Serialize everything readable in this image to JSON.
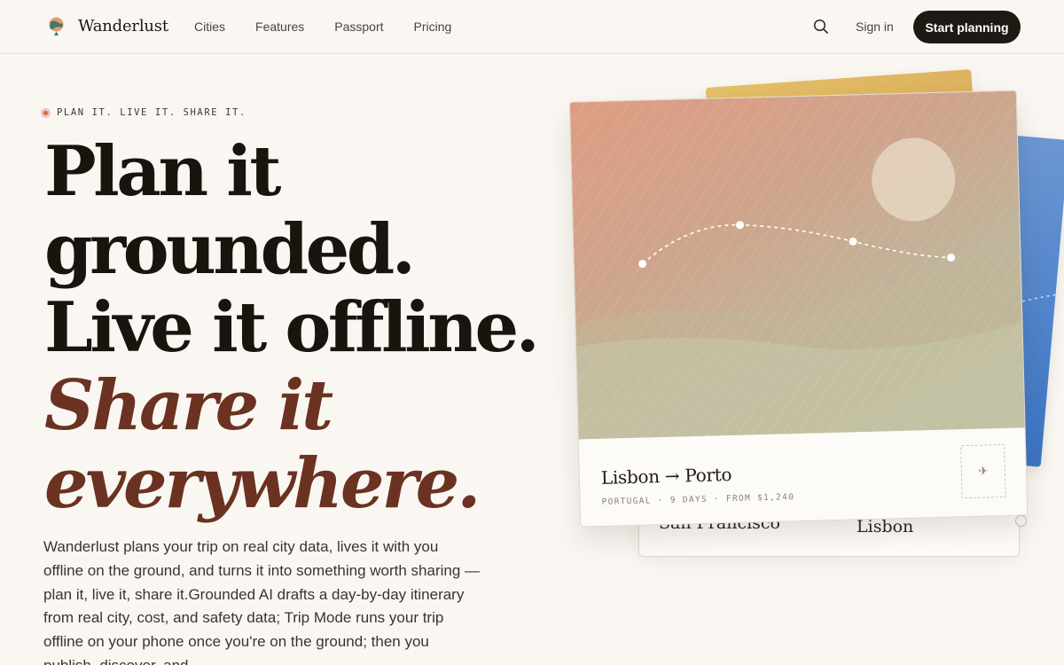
{
  "brand": {
    "name": "Wanderlust",
    "logo_icon": "globe-pin-icon"
  },
  "nav": {
    "items": [
      {
        "label": "Cities"
      },
      {
        "label": "Features"
      },
      {
        "label": "Passport"
      },
      {
        "label": "Pricing"
      }
    ],
    "search_icon": "search-icon",
    "signin_label": "Sign in",
    "cta_label": "Start planning"
  },
  "hero": {
    "eyebrow": "PLAN IT. LIVE IT. SHARE IT.",
    "headline": {
      "line1": "Plan it",
      "line2": "grounded.",
      "line3": "Live it offline.",
      "accent1": "Share it",
      "accent2": "everywhere."
    },
    "lede": "Wanderlust plans your trip on real city data, lives it with you offline on the ground, and turns it into something worth sharing — plan it, live it, share it.Grounded AI drafts a day-by-day itinerary from real city, cost, and safety data; Trip Mode runs your trip offline on your phone once you're on the ground; then you publish, discover, and"
  },
  "cards": {
    "main": {
      "route": "Lisbon → Porto",
      "meta": "PORTUGAL · 9 DAYS · FROM $1,240",
      "stamp_icon": "plane-icon"
    },
    "under": {
      "from": "San Francisco",
      "to": "Lisbon"
    }
  },
  "colors": {
    "background": "#faf7f2",
    "ink": "#1a140f",
    "accent": "#6b3222",
    "cta": "#1f1914",
    "dot": "#d7684a"
  }
}
